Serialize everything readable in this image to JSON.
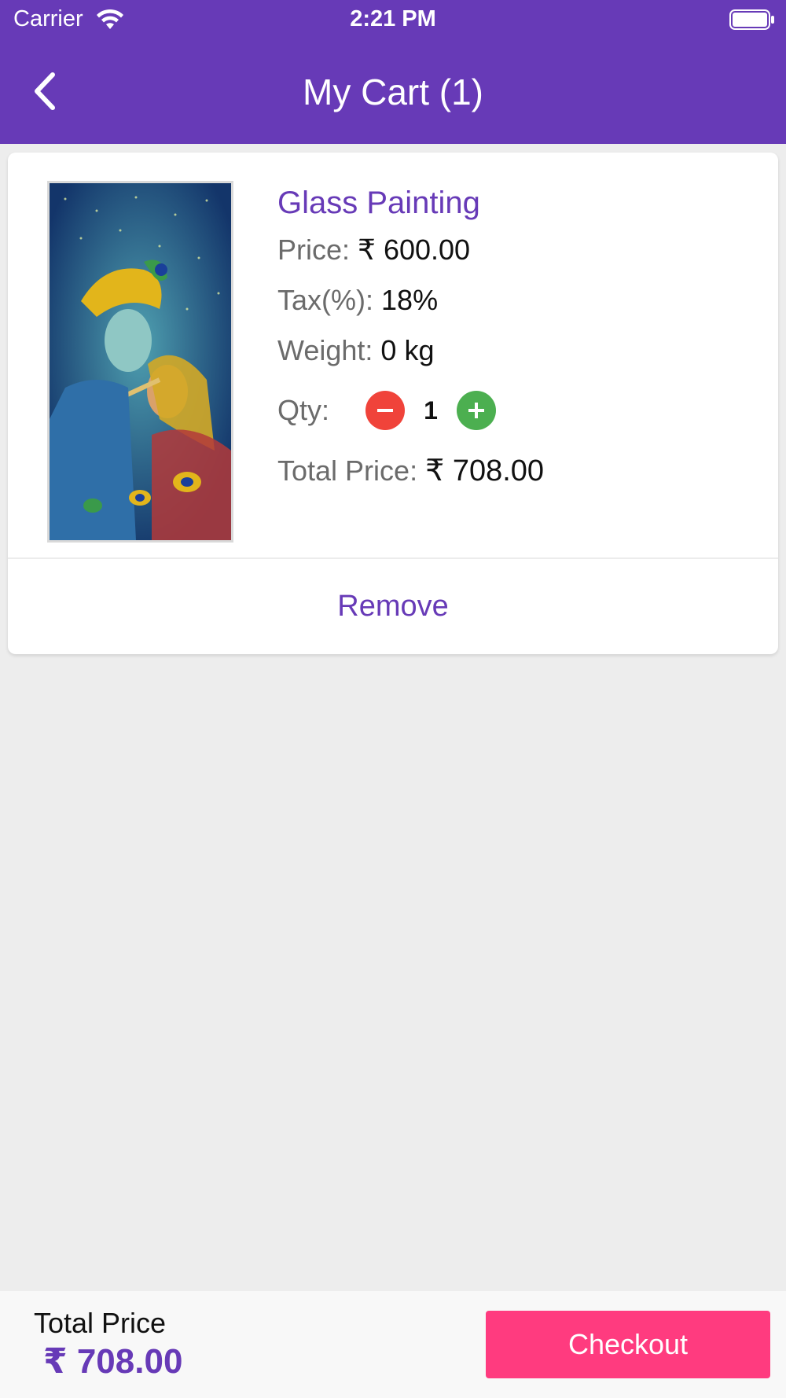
{
  "status_bar": {
    "carrier": "Carrier",
    "time": "2:21 PM"
  },
  "nav": {
    "back_icon": "chevron-left-icon",
    "title": "My Cart (1)"
  },
  "cart_item": {
    "name": "Glass Painting",
    "price_label": "Price:",
    "price_value": "₹ 600.00",
    "tax_label": "Tax(%):",
    "tax_value": "18%",
    "weight_label": "Weight:",
    "weight_value": "0 kg",
    "qty_label": "Qty:",
    "qty_value": "1",
    "total_label": "Total Price:",
    "total_value": "₹ 708.00",
    "remove_label": "Remove"
  },
  "footer": {
    "total_label": "Total Price",
    "total_value": "₹ 708.00",
    "checkout_label": "Checkout"
  },
  "colors": {
    "brand": "#673ab7",
    "checkout": "#ff3b7f",
    "minus": "#f0433a",
    "plus": "#4caf50"
  }
}
